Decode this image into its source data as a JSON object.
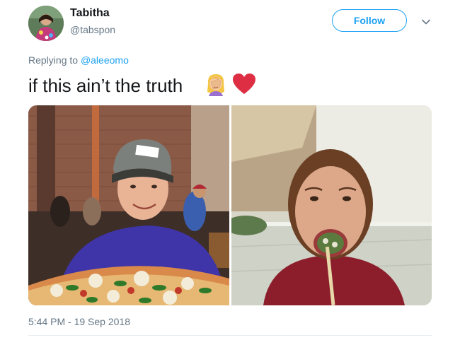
{
  "author": {
    "name": "Tabitha",
    "handle": "@tabspon"
  },
  "follow_label": "Follow",
  "reply": {
    "prefix": "Replying to ",
    "to_handle": "@aleeomo"
  },
  "tweet": {
    "text": "if this ain’t the truth",
    "emojis": [
      "woman-facepalming-emoji",
      "red-heart-emoji"
    ]
  },
  "photos": [
    {
      "icon": "photo-young-man-with-pizza"
    },
    {
      "icon": "photo-young-woman-eating-sushi"
    }
  ],
  "timestamp": "5:44 PM - 19 Sep 2018",
  "colors": {
    "accent": "#1da1f2",
    "secondary_text": "#657786",
    "primary_text": "#14171a",
    "heart": "#e0245e"
  }
}
